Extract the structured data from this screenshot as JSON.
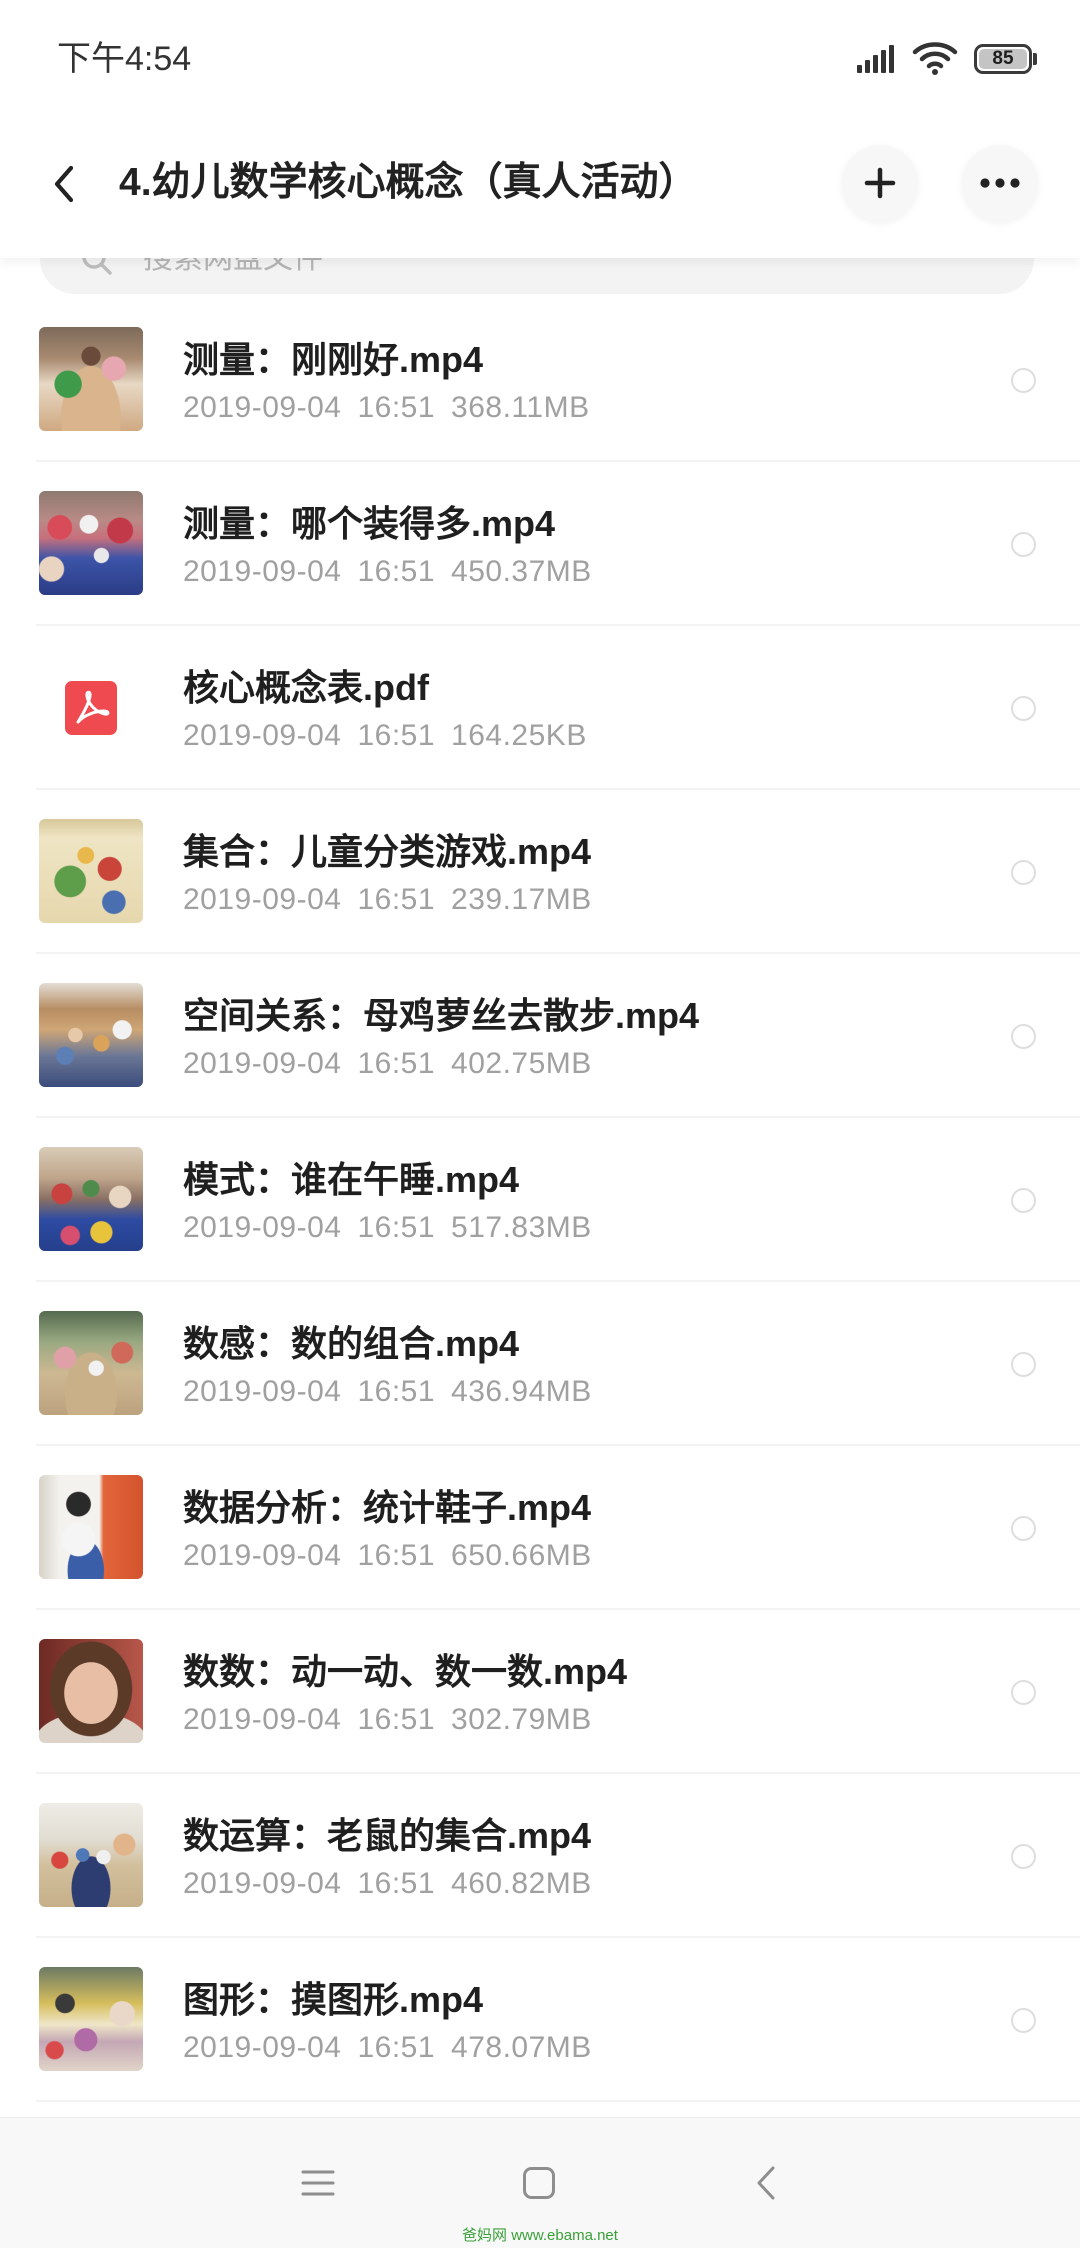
{
  "status_bar": {
    "time": "下午4:54",
    "battery": "85",
    "icons": [
      "signal-icon",
      "wifi-icon",
      "battery-icon"
    ]
  },
  "header": {
    "title": "4.幼儿数学核心概念（真人活动）",
    "back_icon": "chevron-left-icon",
    "add_icon": "plus-icon",
    "more_icon": "more-dots-icon"
  },
  "search": {
    "placeholder": "搜索网盘文件",
    "icon": "search-icon"
  },
  "files": [
    {
      "name": "测量：刚刚好.mp4",
      "date": "2019-09-04",
      "time": "16:51",
      "size": "368.11MB",
      "icon": "video-thumbnail"
    },
    {
      "name": "测量：哪个装得多.mp4",
      "date": "2019-09-04",
      "time": "16:51",
      "size": "450.37MB",
      "icon": "video-thumbnail"
    },
    {
      "name": "核心概念表.pdf",
      "date": "2019-09-04",
      "time": "16:51",
      "size": "164.25KB",
      "icon": "pdf-icon"
    },
    {
      "name": "集合：儿童分类游戏.mp4",
      "date": "2019-09-04",
      "time": "16:51",
      "size": "239.17MB",
      "icon": "video-thumbnail"
    },
    {
      "name": "空间关系：母鸡萝丝去散步.mp4",
      "date": "2019-09-04",
      "time": "16:51",
      "size": "402.75MB",
      "icon": "video-thumbnail"
    },
    {
      "name": "模式：谁在午睡.mp4",
      "date": "2019-09-04",
      "time": "16:51",
      "size": "517.83MB",
      "icon": "video-thumbnail"
    },
    {
      "name": "数感：数的组合.mp4",
      "date": "2019-09-04",
      "time": "16:51",
      "size": "436.94MB",
      "icon": "video-thumbnail"
    },
    {
      "name": "数据分析：统计鞋子.mp4",
      "date": "2019-09-04",
      "time": "16:51",
      "size": "650.66MB",
      "icon": "video-thumbnail"
    },
    {
      "name": "数数：动一动、数一数.mp4",
      "date": "2019-09-04",
      "time": "16:51",
      "size": "302.79MB",
      "icon": "video-thumbnail"
    },
    {
      "name": "数运算：老鼠的集合.mp4",
      "date": "2019-09-04",
      "time": "16:51",
      "size": "460.82MB",
      "icon": "video-thumbnail"
    },
    {
      "name": "图形：摸图形.mp4",
      "date": "2019-09-04",
      "time": "16:51",
      "size": "478.07MB",
      "icon": "video-thumbnail"
    }
  ],
  "nav_bar": {
    "menu_icon": "menu-icon",
    "home_icon": "home-square-icon",
    "back_icon": "nav-back-icon"
  },
  "watermark": "爸妈网 www.ebama.net",
  "colors": {
    "title_text": "#1f1f1f",
    "meta_text": "#a0a0a0",
    "pdf_icon": "#ef4a4f",
    "watermark": "#3aa03a"
  }
}
